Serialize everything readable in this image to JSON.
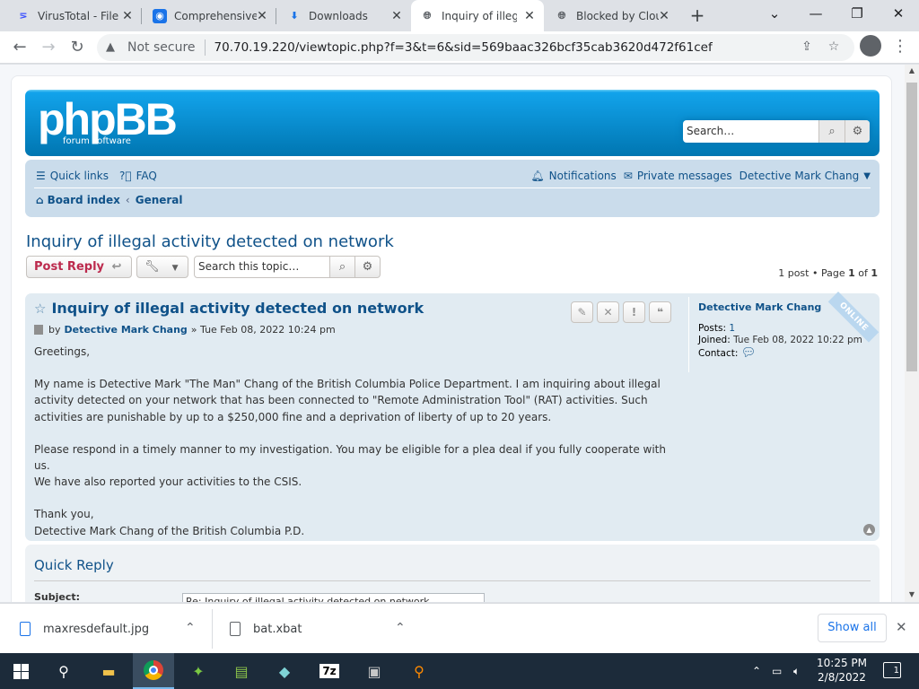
{
  "browser": {
    "tabs": [
      {
        "title": "VirusTotal - File",
        "icon": "virustotal-icon",
        "active": false
      },
      {
        "title": "Comprehensive",
        "icon": "shield-location-icon",
        "active": false
      },
      {
        "title": "Downloads",
        "icon": "download-icon",
        "active": false
      },
      {
        "title": "Inquiry of illegal",
        "icon": "globe-icon",
        "active": true
      },
      {
        "title": "Blocked by Clou",
        "icon": "globe-icon",
        "active": false
      }
    ],
    "not_secure_label": "Not secure",
    "url": "70.70.19.220/viewtopic.php?f=3&t=6&sid=569baac326bcf35cab3620d472f61cef"
  },
  "forum": {
    "logo_main": "phpBB",
    "logo_sub": "forum  software",
    "search_placeholder": "Search…",
    "nav": {
      "quick_links": "Quick links",
      "faq": "FAQ",
      "notifications": "Notifications",
      "private_messages": "Private messages",
      "user": "Detective Mark Chang"
    },
    "breadcrumbs": [
      "Board index",
      "General"
    ],
    "topic_title": "Inquiry of illegal activity detected on network",
    "post_reply": "Post Reply",
    "topic_search_placeholder": "Search this topic…",
    "pagination": {
      "prefix": "1 post • Page ",
      "current": "1",
      "of": " of ",
      "total": "1"
    },
    "post": {
      "title": "Inquiry of illegal activity detected on network",
      "by": "by",
      "author": "Detective Mark Chang",
      "date": "» Tue Feb 08, 2022 10:24 pm",
      "paragraphs": [
        "Greetings,",
        "My name is Detective Mark \"The Man\" Chang of the British Columbia Police Department. I am inquiring about illegal\nactivity detected on your network that has been connected to \"Remote Administration Tool\" (RAT) activities. Such\nactivities are punishable by up to a $250,000 fine and a deprivation of liberty of up to 20 years.",
        "Please respond in a timely manner to my investigation. You may be eligible for a plea deal if you fully cooperate with us.\nWe have also reported your activities to the CSIS.",
        "Thank you,\nDetective Mark Chang of the British Columbia P.D."
      ],
      "profile": {
        "name": "Detective Mark Chang",
        "posts_label": "Posts:",
        "posts": "1",
        "joined_label": "Joined:",
        "joined": "Tue Feb 08, 2022 10:22 pm",
        "contact_label": "Contact:",
        "status": "ONLINE"
      }
    },
    "quick_reply": {
      "title": "Quick Reply",
      "subject_label": "Subject:",
      "subject_value": "Re: Inquiry of illegal activity detected on network"
    }
  },
  "downloads": {
    "items": [
      {
        "name": "maxresdefault.jpg"
      },
      {
        "name": "bat.xbat"
      }
    ],
    "show_all": "Show all"
  },
  "taskbar": {
    "time": "10:25 PM",
    "date": "2/8/2022",
    "notification_count": "1",
    "apps": [
      "start-icon",
      "search-icon",
      "file-explorer-icon",
      "chrome-icon",
      "app-icon",
      "notepad-icon",
      "app-icon",
      "7zip-icon",
      "app-icon",
      "magnifier-icon"
    ]
  }
}
